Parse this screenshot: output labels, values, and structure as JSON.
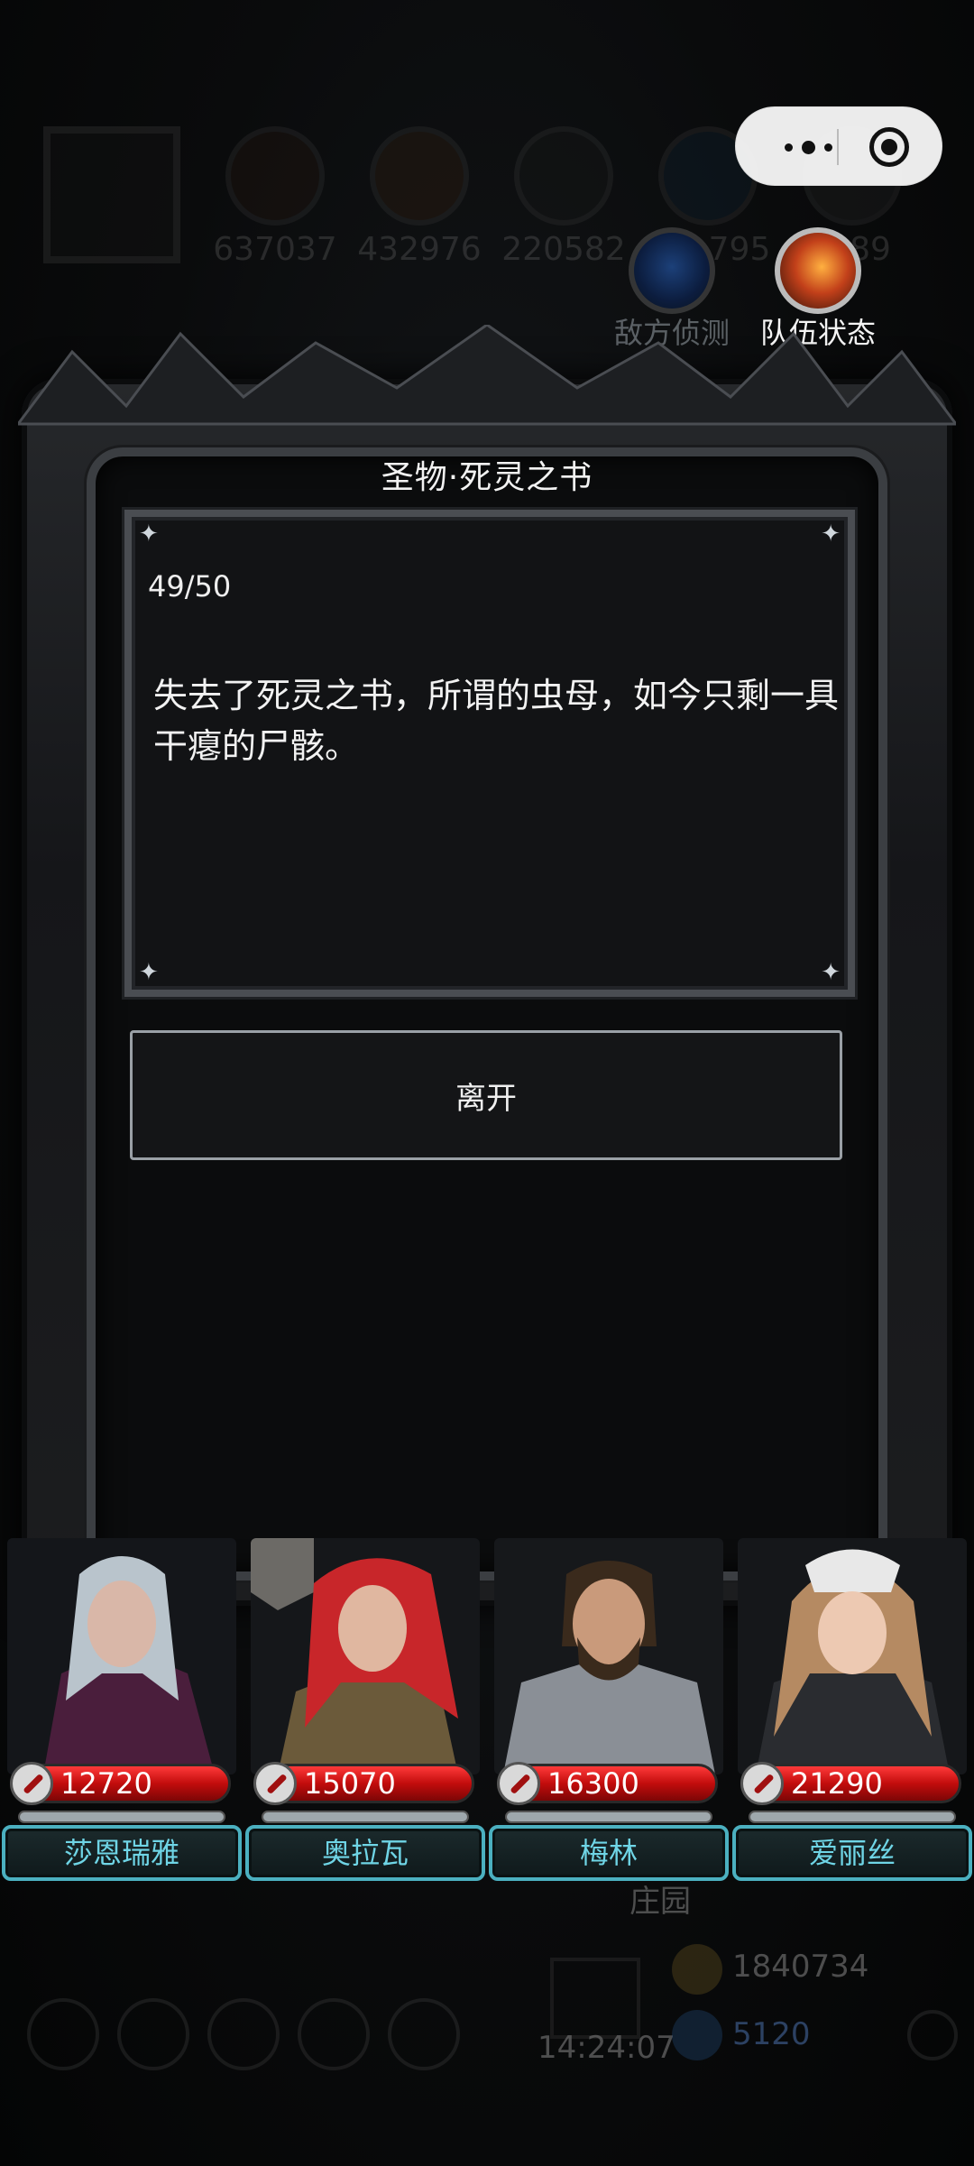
{
  "resources": [
    {
      "value": "637037"
    },
    {
      "value": "432976"
    },
    {
      "value": "220582"
    },
    {
      "value": "795"
    },
    {
      "value": "89"
    }
  ],
  "top_buttons": {
    "enemy_scout": "敌方侦测",
    "team_status": "队伍状态"
  },
  "dialog": {
    "title": "圣物·死灵之书",
    "counter": "49/50",
    "story": "失去了死灵之书，所谓的虫母，如今只剩一具干瘪的尸骸。",
    "leave_label": "离开"
  },
  "heroes": [
    {
      "name": "莎恩瑞雅",
      "hp": "12720",
      "colors": {
        "hair": "#b9c4cc",
        "robe": "#4a1e3c",
        "skin": "#d9b7a8"
      }
    },
    {
      "name": "奥拉瓦",
      "hp": "15070",
      "colors": {
        "hair": "#c8262a",
        "robe": "#6b5a3a",
        "skin": "#e0b7a0"
      }
    },
    {
      "name": "梅林",
      "hp": "16300",
      "colors": {
        "hair": "#3a2a1c",
        "robe": "#8a8f96",
        "skin": "#c99a7b"
      }
    },
    {
      "name": "爱丽丝",
      "hp": "21290",
      "colors": {
        "hair": "#b58a62",
        "robe": "#2a2c30",
        "skin": "#edc9b2"
      }
    }
  ],
  "background": {
    "faded_label": "庄园",
    "time": "14:24:07",
    "gold": "1840734",
    "gems": "5120"
  }
}
